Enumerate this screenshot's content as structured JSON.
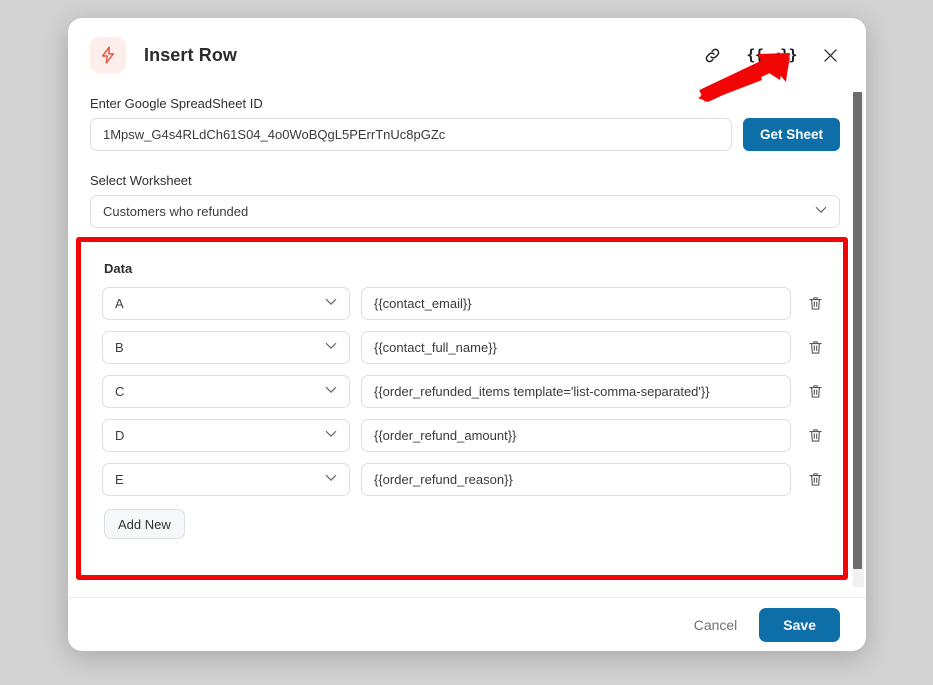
{
  "window": {
    "background_color": "#d2d2d2"
  },
  "modal": {
    "title": "Insert Row",
    "app_icon": "lightning-bolt-icon",
    "header_actions": [
      {
        "name": "link-icon",
        "label": ""
      },
      {
        "name": "variables-icon",
        "label": "{{..}}"
      },
      {
        "name": "close-icon",
        "label": ""
      }
    ],
    "variables_icon_text": "{{..}}",
    "spreadsheet": {
      "label": "Enter Google SpreadSheet ID",
      "value": "1Mpsw_G4s4RLdCh61S04_4o0WoBQgL5PErrTnUc8pGZc",
      "placeholder": "Enter Google SpreadSheet ID",
      "button_label": "Get Sheet"
    },
    "worksheet": {
      "label": "Select Worksheet",
      "selected": "Customers who refunded"
    },
    "data_section": {
      "title": "Data",
      "rows": [
        {
          "column": "A",
          "value": "{{contact_email}}"
        },
        {
          "column": "B",
          "value": "{{contact_full_name}}"
        },
        {
          "column": "C",
          "value": "{{order_refunded_items template='list-comma-separated'}}"
        },
        {
          "column": "D",
          "value": "{{order_refund_amount}}"
        },
        {
          "column": "E",
          "value": "{{order_refund_reason}}"
        }
      ],
      "add_new_label": "Add New",
      "delete_icon": "trash-icon"
    },
    "footer": {
      "cancel_label": "Cancel",
      "save_label": "Save"
    }
  },
  "colors": {
    "primary_button": "#0d6ea8",
    "annotation_red": "#f20505",
    "bolt_accent": "#e8573f",
    "bolt_badge_bg": "#fdeeeb"
  }
}
